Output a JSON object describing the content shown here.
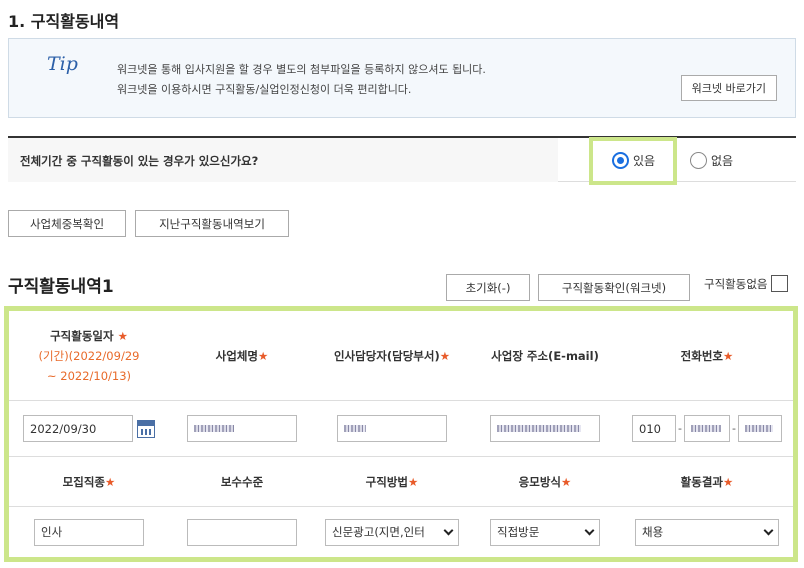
{
  "page": {
    "title": "1. 구직활동내역"
  },
  "tip": {
    "mark": "Tip",
    "line1": "워크넷을 통해 입사지원을 할 경우 별도의 첨부파일을 등록하지 않으셔도 됩니다.",
    "line2": "워크넷을 이용하시면 구직활동/실업인정신청이 더욱 편리합니다.",
    "button": "워크넷 바로가기"
  },
  "question": {
    "text": "전체기간 중 구직활동이 있는 경우가 있으신가요?",
    "yes": "있음",
    "no": "없음",
    "selected": "yes"
  },
  "actions": {
    "dup_check": "사업체중복확인",
    "past_view": "지난구직활동내역보기"
  },
  "section": {
    "title": "구직활동내역1",
    "reset": "초기화(-)",
    "check": "구직활동확인(워크넷)",
    "no_activity": "구직활동없음"
  },
  "table": {
    "head1": {
      "date": "구직활동일자",
      "period": "(기간)(2022/09/29",
      "period2": "~ 2022/10/13)",
      "company": "사업체명",
      "hr": "인사담당자(담당부서)",
      "address": "사업장 주소(E-mail)",
      "phone": "전화번호"
    },
    "row1": {
      "date": "2022/09/30",
      "phone_prefix": "010",
      "sep": "-"
    },
    "head2": {
      "job": "모집직종",
      "salary": "보수수준",
      "method": "구직방법",
      "apply": "응모방식",
      "result": "활동결과"
    },
    "row2": {
      "job": "인사",
      "salary": "",
      "method": "신문광고(지면,인터",
      "apply": "직접방문",
      "result": "채용"
    },
    "star": "★"
  },
  "colors": {
    "highlight": "#cce68a",
    "accent": "#e85b2a",
    "radio": "#1a6fe0"
  }
}
